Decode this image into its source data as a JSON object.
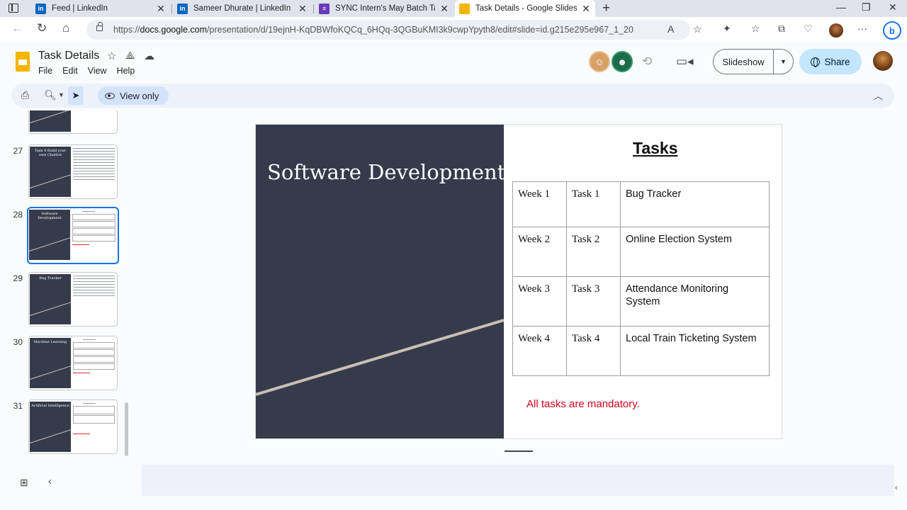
{
  "browser": {
    "tabs": [
      {
        "label": "Feed | LinkedIn",
        "favicon": "linkedin-icon"
      },
      {
        "label": "Sameer Dhurate | LinkedIn",
        "favicon": "linkedin-icon"
      },
      {
        "label": "SYNC Intern's May Batch Task Su",
        "favicon": "google-forms-icon"
      },
      {
        "label": "Task Details - Google Slides",
        "favicon": "google-slides-icon"
      }
    ],
    "url_prefix": "https://",
    "url_domain": "docs.google.com",
    "url_path": "/presentation/d/19ejnH-KqDBWfoKQCq_6HQq-3QGBuKMI3k9cwpYpyth8/edit#slide=id.g215e295e967_1_20"
  },
  "app": {
    "title": "Task Details",
    "menu": [
      "File",
      "Edit",
      "View",
      "Help"
    ],
    "slideshow_label": "Slideshow",
    "share_label": "Share",
    "view_only_label": "View only"
  },
  "filmstrip": [
    {
      "number": "",
      "title": ""
    },
    {
      "number": "27",
      "title": "Task 4 Build your own Chatbot"
    },
    {
      "number": "28",
      "title": "Software Development",
      "selected": true
    },
    {
      "number": "29",
      "title": "Bug Tracker"
    },
    {
      "number": "30",
      "title": "Machine Learning"
    },
    {
      "number": "31",
      "title": "Artificial Intelligence"
    }
  ],
  "slide": {
    "title": "Software Development",
    "heading": "Tasks",
    "rows": [
      {
        "week": "Week 1",
        "task": "Task 1",
        "name": "Bug Tracker"
      },
      {
        "week": "Week 2",
        "task": "Task 2",
        "name": "Online Election System"
      },
      {
        "week": "Week 3",
        "task": "Task 3",
        "name": "Attendance Monitoring System"
      },
      {
        "week": "Week 4",
        "task": "Task 4",
        "name": "Local Train Ticketing System"
      }
    ],
    "note": "All tasks are mandatory."
  },
  "colors": {
    "slide_dark_panel": "#353b4b",
    "accent_line": "#c9bfb3",
    "mandatory_text": "#d0021b",
    "share_button": "#c2e7ff",
    "selection_border": "#1a73e8"
  }
}
